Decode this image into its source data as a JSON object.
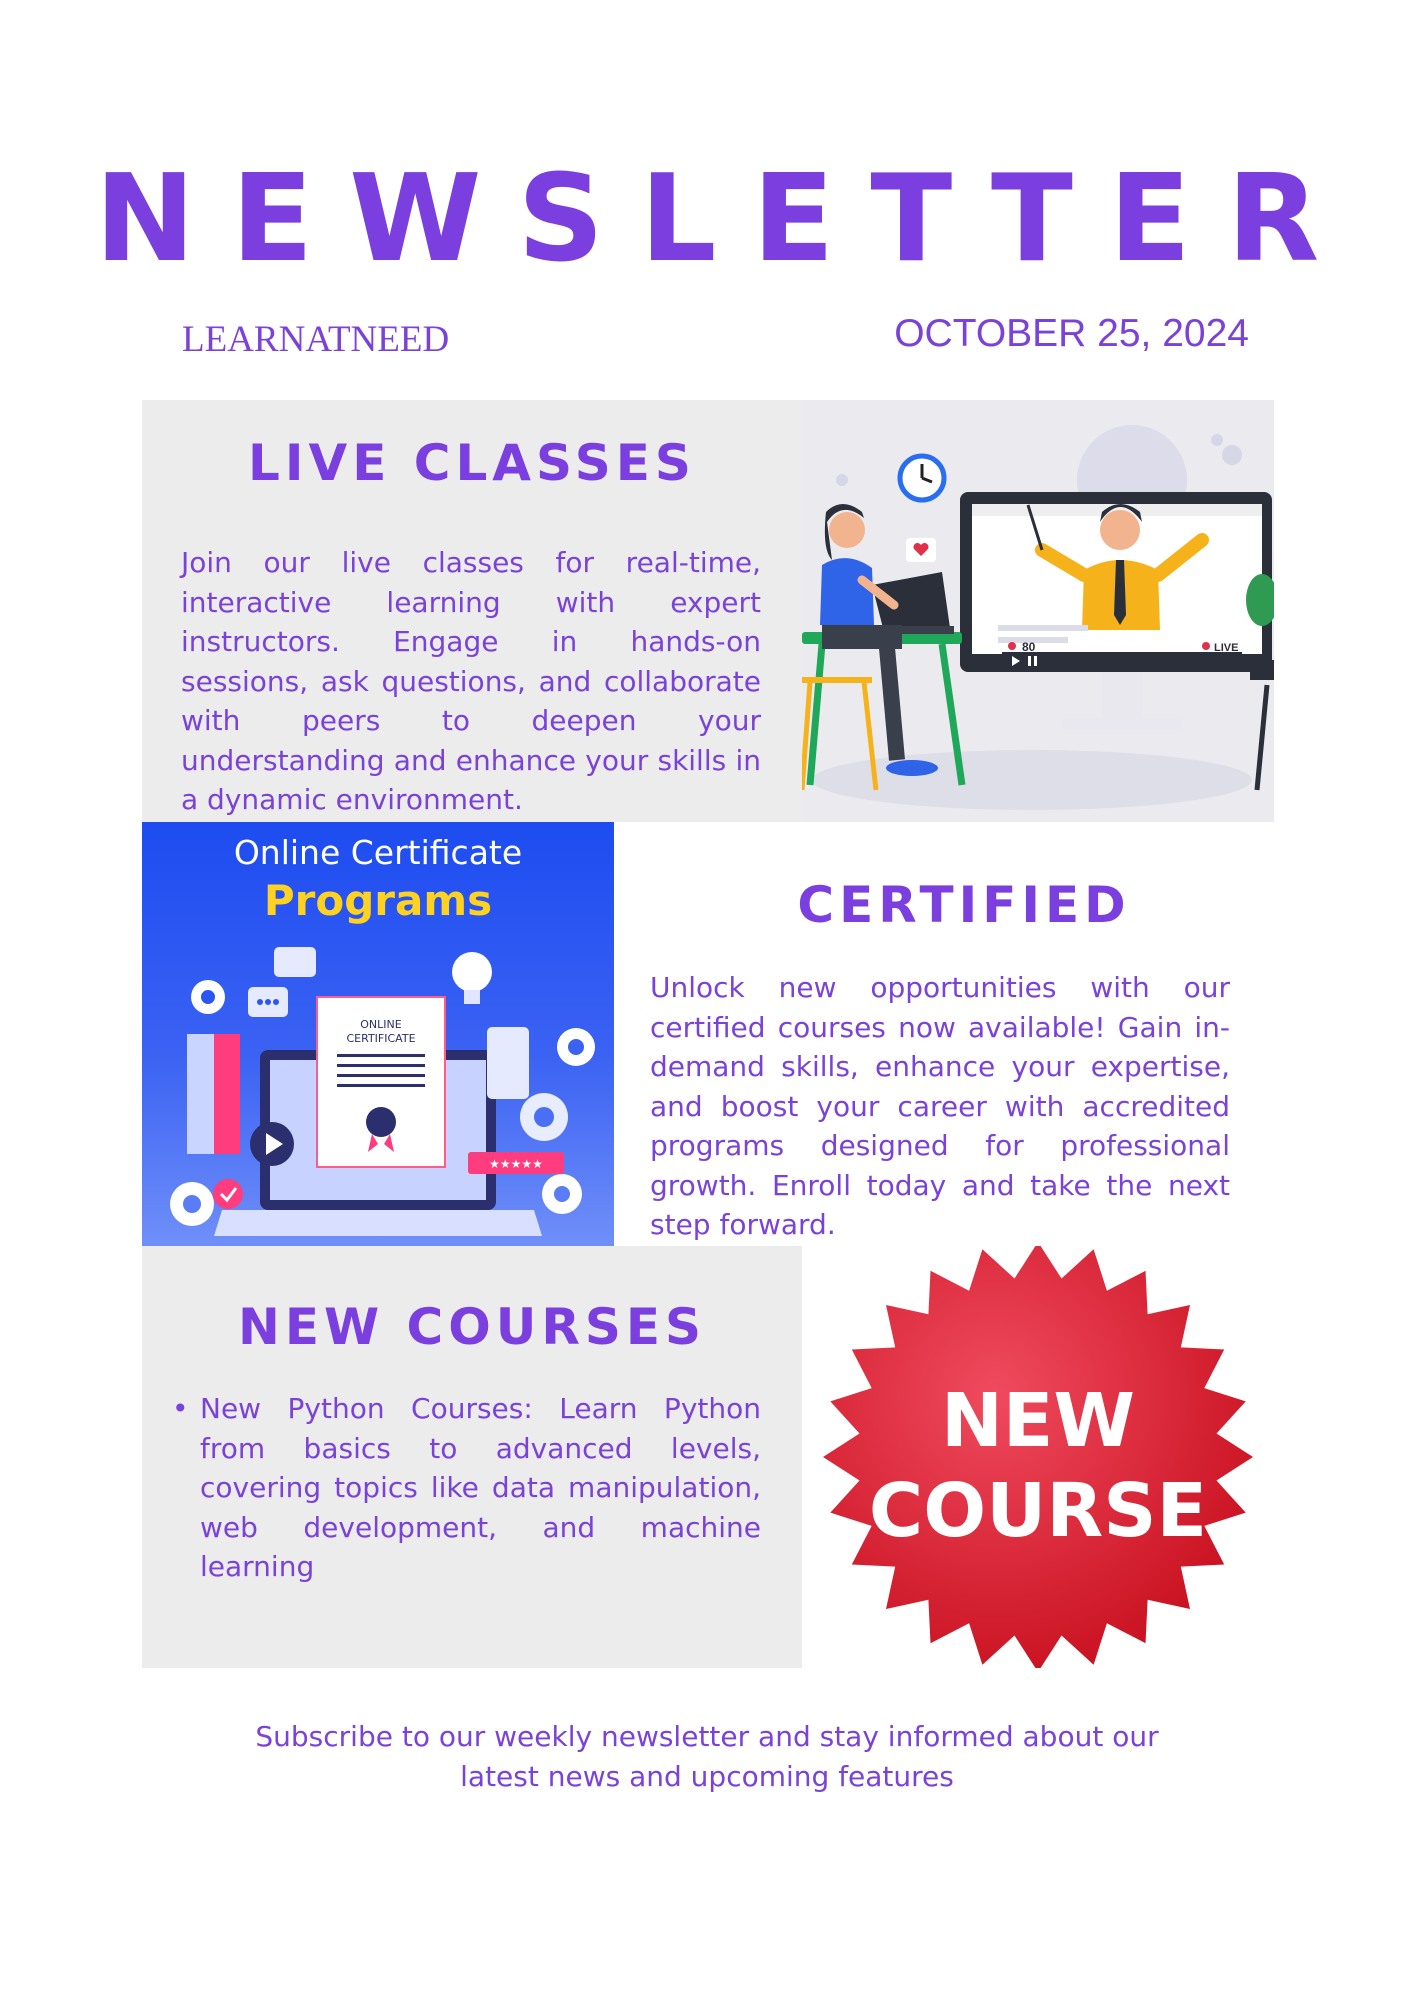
{
  "header": {
    "title": "NEWSLETTER",
    "organization": "LEARNATNEED",
    "date": "OCTOBER 25, 2024"
  },
  "live_classes": {
    "heading": "LIVE CLASSES",
    "text": "Join our live classes for real-time, interactive learning with expert instructors. Engage in hands-on sessions, ask questions, and collaborate with peers to deepen your understanding and enhance your skills in a dynamic environment.",
    "illustration": {
      "viewer_count": "80",
      "live_label": "LIVE",
      "icon": "online-class-illustration"
    }
  },
  "certified": {
    "heading": "CERTIFIED",
    "text": "Unlock new opportunities with our certified courses now available! Gain in-demand skills, enhance your expertise, and boost your career with accredited programs designed for professional growth. Enroll today and take the next step forward.",
    "image": {
      "line1": "Online Certificate",
      "line2": "Programs",
      "certificate_line1": "ONLINE",
      "certificate_line2": "CERTIFICATE",
      "stars": "★★★★★"
    }
  },
  "new_courses": {
    "heading": "NEW COURSES",
    "items": [
      "New Python Courses: Learn Python from basics to advanced levels, covering topics like data manipulation, web development, and machine learning"
    ],
    "badge": {
      "line1": "NEW",
      "line2": "COURSE"
    }
  },
  "footer": {
    "line1": "Subscribe to our weekly newsletter and stay informed about our",
    "line2": "latest news and upcoming features"
  },
  "colors": {
    "accent": "#7b3fe0",
    "panel_grey": "#ececec",
    "badge_red": "#e0182d",
    "cert_blue": "#1d4cf0",
    "cert_yellow": "#ffd21f"
  }
}
